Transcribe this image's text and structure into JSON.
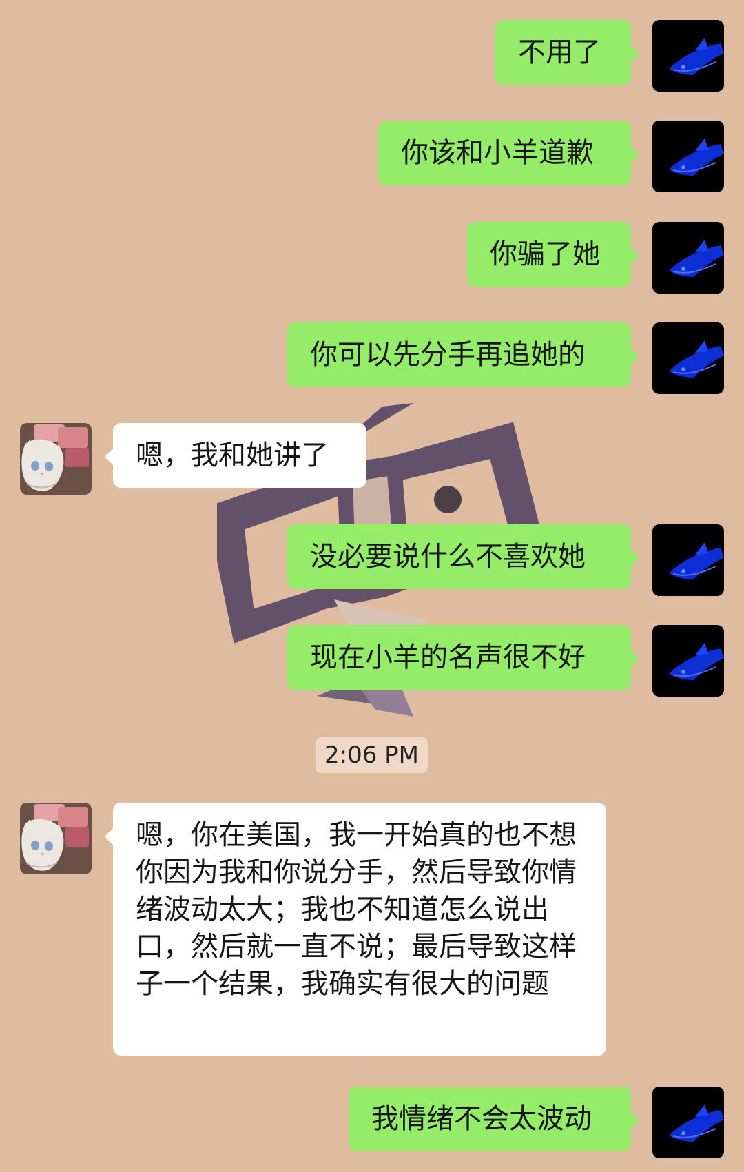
{
  "conversation": {
    "messages": [
      {
        "side": "right",
        "text": "不用了"
      },
      {
        "side": "right",
        "text": "你该和小羊道歉"
      },
      {
        "side": "right",
        "text": "你骗了她"
      },
      {
        "side": "right",
        "text": "你可以先分手再追她的"
      },
      {
        "side": "left",
        "text": "嗯，我和她讲了"
      },
      {
        "side": "right",
        "text": "没必要说什么不喜欢她"
      },
      {
        "side": "right",
        "text": "现在小羊的名声很不好"
      },
      {
        "side": "system",
        "text": "2:06 PM"
      },
      {
        "side": "left",
        "text": "嗯，你在美国，我一开始真的也不想你因为我和你说分手，然后导致你情绪波动太大；我也不知道怎么说出口，然后就一直不说；最后导致这样子一个结果，我确实有很大的问题"
      },
      {
        "side": "right",
        "text": "我情绪不会太波动"
      }
    ]
  },
  "avatars": {
    "self": "blue-shark-icon",
    "contact": "cat-with-cash-icon"
  },
  "colors": {
    "background": "#dfbc9f",
    "outgoing_bubble": "#95ec69",
    "incoming_bubble": "#ffffff",
    "timestamp_pill": "#efd8c7"
  }
}
